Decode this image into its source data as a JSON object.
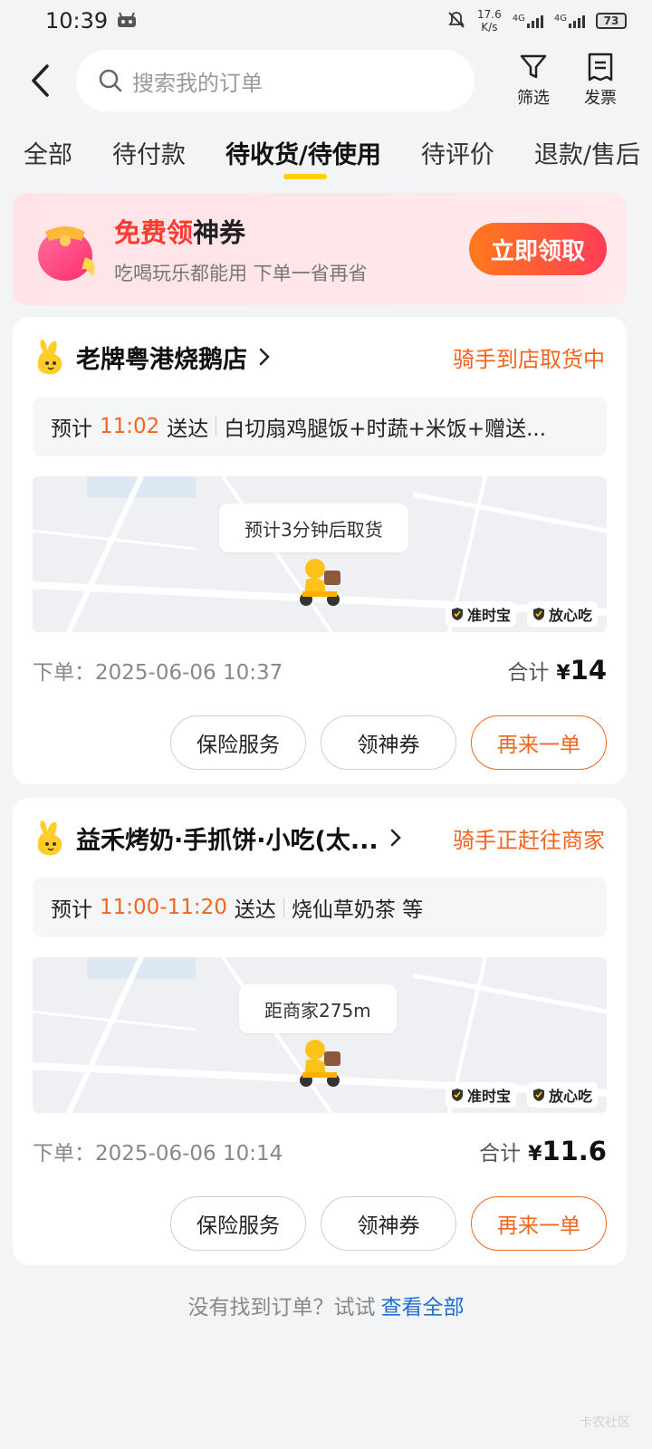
{
  "status_bar": {
    "time": "10:39",
    "speed_value": "17.6",
    "speed_unit": "K/s",
    "network1": "4G",
    "network2": "4G",
    "battery": "73"
  },
  "header": {
    "search_placeholder": "搜索我的订单",
    "filter_label": "筛选",
    "invoice_label": "发票"
  },
  "tabs": [
    {
      "label": "全部",
      "active": false
    },
    {
      "label": "待付款",
      "active": false
    },
    {
      "label": "待收货/待使用",
      "active": true
    },
    {
      "label": "待评价",
      "active": false
    },
    {
      "label": "退款/售后",
      "active": false
    }
  ],
  "banner": {
    "title_highlight": "免费领",
    "title_rest": "神券",
    "subtitle": "吃喝玩乐都能用 下单一省再省",
    "button": "立即领取"
  },
  "orders": [
    {
      "store": "老牌粤港烧鹅店",
      "status": "骑手到店取货中",
      "eta_prefix": "预计",
      "eta_time": "11:02",
      "eta_suffix": "送达",
      "items": "白切扇鸡腿饭+时蔬+米饭+赠送...",
      "map_bubble": "预计3分钟后取货",
      "badge1": "准时宝",
      "badge2": "放心吃",
      "order_time": "下单：2025-06-06 10:37",
      "total_label": "合计",
      "currency": "¥",
      "total": "14",
      "btn1": "保险服务",
      "btn2": "领神券",
      "btn3": "再来一单"
    },
    {
      "store": "益禾烤奶·手抓饼·小吃(太...",
      "status": "骑手正赶往商家",
      "eta_prefix": "预计",
      "eta_time": "11:00-11:20",
      "eta_suffix": "送达",
      "items": "烧仙草奶茶 等",
      "map_bubble": "距商家275m",
      "badge1": "准时宝",
      "badge2": "放心吃",
      "order_time": "下单：2025-06-06 10:14",
      "total_label": "合计",
      "currency": "¥",
      "total": "11.6",
      "btn1": "保险服务",
      "btn2": "领神券",
      "btn3": "再来一单"
    }
  ],
  "footer": {
    "text": "没有找到订单？试试",
    "link": "查看全部"
  },
  "watermark": "卡农社区",
  "colors": {
    "accent_orange": "#f2651c",
    "tab_underline": "#ffd100",
    "link_blue": "#1f6fd1",
    "promo_red": "#ff3a2f"
  }
}
